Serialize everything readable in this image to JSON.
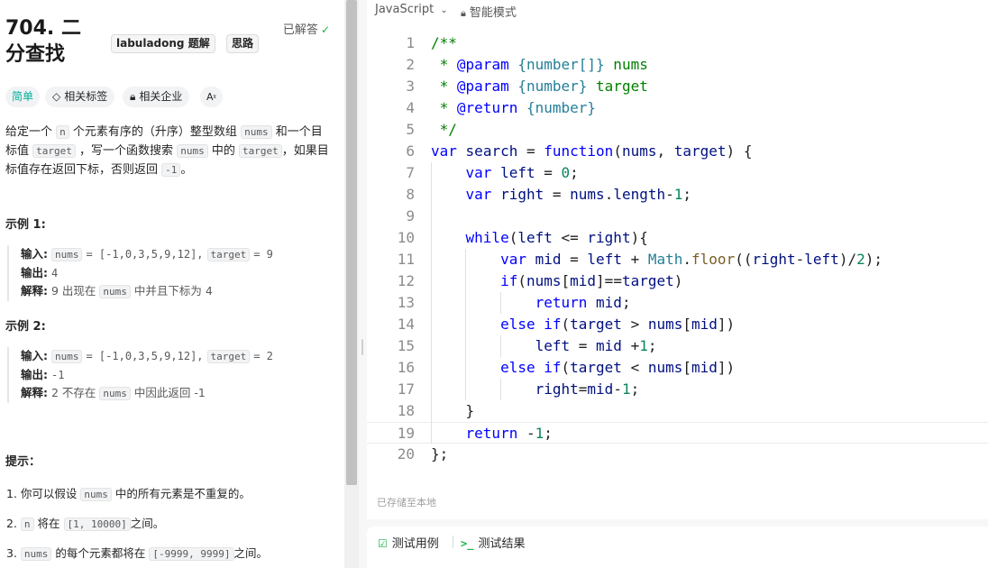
{
  "problem": {
    "title": "704. 二分查找",
    "badges": [
      "labuladong 题解",
      "思路"
    ],
    "status": "已解答",
    "status_icon": "check-circle-icon",
    "chips": [
      "简单",
      "相关标签",
      "相关企业",
      "Aあ"
    ],
    "description": {
      "p1": "给定一个",
      "n": "n",
      "p2": "个元素有序的（升序）整型数组",
      "nums": "nums",
      "p3": "和一个目标值",
      "target": "target",
      "p4": "，写一个函数搜索",
      "nums2": "nums",
      "p5": "中的",
      "target2": "target",
      "p6": "，如果目标值存在返回下标，否则返回",
      "minus1": "-1",
      "p7": "。"
    },
    "example1": {
      "heading": "示例 1:",
      "input_label": "输入:",
      "input_nums": "nums",
      "input_eq": "= [-1,0,3,5,9,12],",
      "input_target": "target",
      "input_target_eq": "= 9",
      "output_label": "输出:",
      "output": "4",
      "explain_label": "解释:",
      "explain_a": "9 出现在",
      "explain_nums": "nums",
      "explain_b": "中并且下标为 4"
    },
    "example2": {
      "heading": "示例 2:",
      "input_label": "输入:",
      "input_nums": "nums",
      "input_eq": "= [-1,0,3,5,9,12],",
      "input_target": "target",
      "input_target_eq": "= 2",
      "output_label": "输出:",
      "output": "-1",
      "explain_label": "解释:",
      "explain_a": "2 不存在",
      "explain_nums": "nums",
      "explain_b": "中因此返回 -1"
    },
    "hints_heading": "提示：",
    "hints": [
      {
        "a": "1. 你可以假设",
        "code": "nums",
        "b": "中的所有元素是不重复的。"
      },
      {
        "a": "2.",
        "code": "n",
        "b": "将在",
        "code2": "[1, 10000]",
        "c": "之间。"
      },
      {
        "a": "3.",
        "code": "nums",
        "b": "的每个元素都将在",
        "code2": "[-9999, 9999]",
        "c": "之间。"
      }
    ]
  },
  "editor": {
    "language": "JavaScript",
    "mode": "智能模式",
    "saved_status": "已存储至本地",
    "active_line": 19,
    "lines": [
      "/**",
      " * @param {number[]} nums",
      " * @param {number} target",
      " * @return {number}",
      " */",
      "var search = function(nums, target) {",
      "    var left = 0;",
      "    var right = nums.length-1;",
      "",
      "    while(left <= right){",
      "        var mid = left + Math.floor((right-left)/2);",
      "        if(nums[mid]==target)",
      "            return mid;",
      "        else if(target > nums[mid])",
      "            left = mid +1;",
      "        else if(target < nums[mid])",
      "            right=mid-1;",
      "    }",
      "    return -1;",
      "};"
    ]
  },
  "bottom_tabs": {
    "test_cases": "测试用例",
    "test_result": "测试结果"
  }
}
